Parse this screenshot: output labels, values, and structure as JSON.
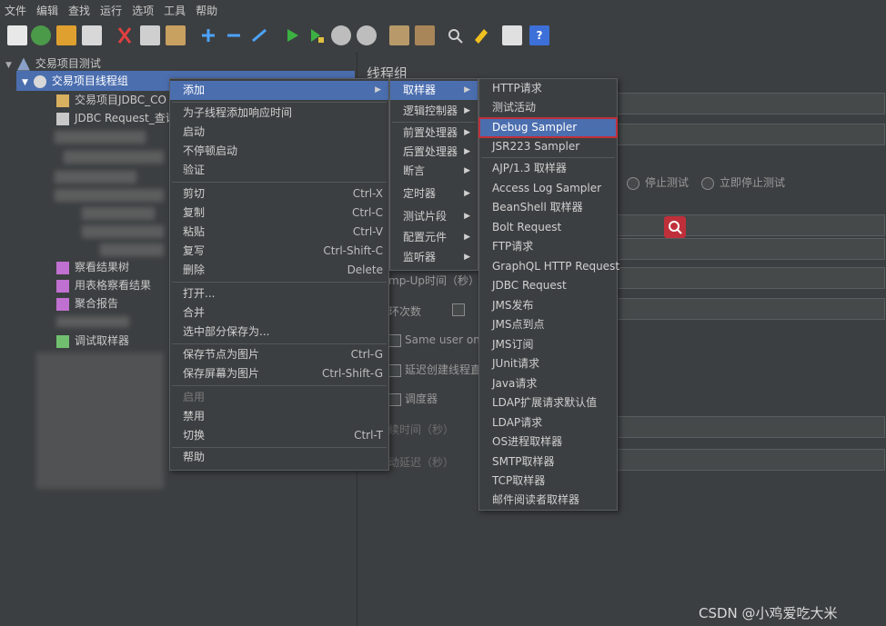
{
  "menubar": {
    "items": [
      "文件",
      "编辑",
      "查找",
      "运行",
      "选项",
      "工具",
      "帮助"
    ]
  },
  "toolbar": {
    "icons": [
      "new-icon",
      "templates-icon",
      "open-icon",
      "save-icon",
      "cut-icon",
      "copy-icon",
      "paste-icon",
      "expand-icon",
      "collapse-icon",
      "toggle-icon",
      "start-icon",
      "start-no-pause-icon",
      "stop-icon",
      "shutdown-icon",
      "clear-icon",
      "clear-all-icon",
      "search-icon",
      "reset-search-icon",
      "function-helper-icon",
      "help-icon"
    ]
  },
  "tree": {
    "test_plan": "交易项目测试",
    "thread_group": "交易项目线程组",
    "children": [
      "交易项目JDBC_CO",
      "JDBC Request_查询"
    ],
    "listeners": [
      "察看结果树",
      "用表格察看结果",
      "聚合报告"
    ],
    "debug_sampler": "调试取样器"
  },
  "panel": {
    "title": "线程组",
    "stop_test": "停止测试",
    "stop_now": "立即停止测试",
    "rampup": "mp-Up时间（秒）",
    "loop": "环次数",
    "same_user": "Same user on e",
    "delay": "延迟创建线程直",
    "scheduler": "调度器",
    "duration": "续时间（秒）",
    "startup_delay": "动延迟（秒）"
  },
  "context_menu": {
    "items": [
      {
        "label": "添加",
        "arrow": true
      },
      {
        "label": "为子线程添加响应时间"
      },
      {
        "label": "启动"
      },
      {
        "label": "不停顿启动"
      },
      {
        "label": "验证"
      },
      {
        "label": "剪切",
        "shortcut": "Ctrl-X"
      },
      {
        "label": "复制",
        "shortcut": "Ctrl-C"
      },
      {
        "label": "粘贴",
        "shortcut": "Ctrl-V"
      },
      {
        "label": "复写",
        "shortcut": "Ctrl-Shift-C"
      },
      {
        "label": "删除",
        "shortcut": "Delete"
      },
      {
        "label": "打开..."
      },
      {
        "label": "合并"
      },
      {
        "label": "选中部分保存为..."
      },
      {
        "label": "保存节点为图片",
        "shortcut": "Ctrl-G"
      },
      {
        "label": "保存屏幕为图片",
        "shortcut": "Ctrl-Shift-G"
      },
      {
        "label": "启用"
      },
      {
        "label": "禁用"
      },
      {
        "label": "切换",
        "shortcut": "Ctrl-T"
      },
      {
        "label": "帮助"
      }
    ]
  },
  "add_menu": {
    "items": [
      "取样器",
      "逻辑控制器",
      "前置处理器",
      "后置处理器",
      "断言",
      "定时器",
      "测试片段",
      "配置元件",
      "监听器"
    ]
  },
  "sampler_menu": {
    "items": [
      "HTTP请求",
      "测试活动",
      "Debug Sampler",
      "JSR223 Sampler",
      "AJP/1.3 取样器",
      "Access Log Sampler",
      "BeanShell 取样器",
      "Bolt Request",
      "FTP请求",
      "GraphQL HTTP Request",
      "JDBC Request",
      "JMS发布",
      "JMS点到点",
      "JMS订阅",
      "JUnit请求",
      "Java请求",
      "LDAP扩展请求默认值",
      "LDAP请求",
      "OS进程取样器",
      "SMTP取样器",
      "TCP取样器",
      "邮件阅读者取样器"
    ]
  },
  "watermark": "CSDN @小鸡爱吃大米",
  "colors": {
    "selection": "#4b6eaf",
    "highlight_border": "#c0303a",
    "background": "#3c3f41"
  }
}
